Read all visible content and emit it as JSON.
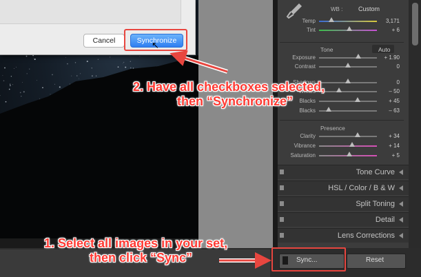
{
  "dialog": {
    "cancel_label": "Cancel",
    "synchronize_label": "Synchronize"
  },
  "basic_panel": {
    "wb_label": "WB :",
    "wb_value": "Custom",
    "sliders": [
      {
        "label": "Temp",
        "value": "3,171"
      },
      {
        "label": "Tint",
        "value": "+ 6"
      },
      {
        "label": "Exposure",
        "value": "+ 1.90"
      },
      {
        "label": "Contrast",
        "value": "0"
      },
      {
        "label": "Shadows",
        "value": "0"
      },
      {
        "label": "Whites",
        "value": "– 50"
      },
      {
        "label": "Blacks",
        "value": "+ 45"
      },
      {
        "label": "Blacks",
        "value": "– 63"
      },
      {
        "label": "Clarity",
        "value": "+ 34"
      },
      {
        "label": "Vibrance",
        "value": "+ 14"
      },
      {
        "label": "Saturation",
        "value": "+ 5"
      }
    ],
    "tone_label": "Tone",
    "auto_label": "Auto",
    "presence_label": "Presence"
  },
  "sections": [
    {
      "label": "Tone Curve"
    },
    {
      "label": "HSL / Color / B & W"
    },
    {
      "label": "Split Toning"
    },
    {
      "label": "Detail"
    },
    {
      "label": "Lens Corrections"
    }
  ],
  "toolbar": {
    "sync_label": "Sync...",
    "reset_label": "Reset"
  },
  "annotations": {
    "step2_line1": "2. Have all checkboxes selected,",
    "step2_line2": "then “Synchronize”",
    "step1_line1": "1. Select all images in your set,",
    "step1_line2": "then click “Sync”"
  },
  "colors": {
    "accent": "#e8463f",
    "mac_blue": "#2f7ff1"
  }
}
